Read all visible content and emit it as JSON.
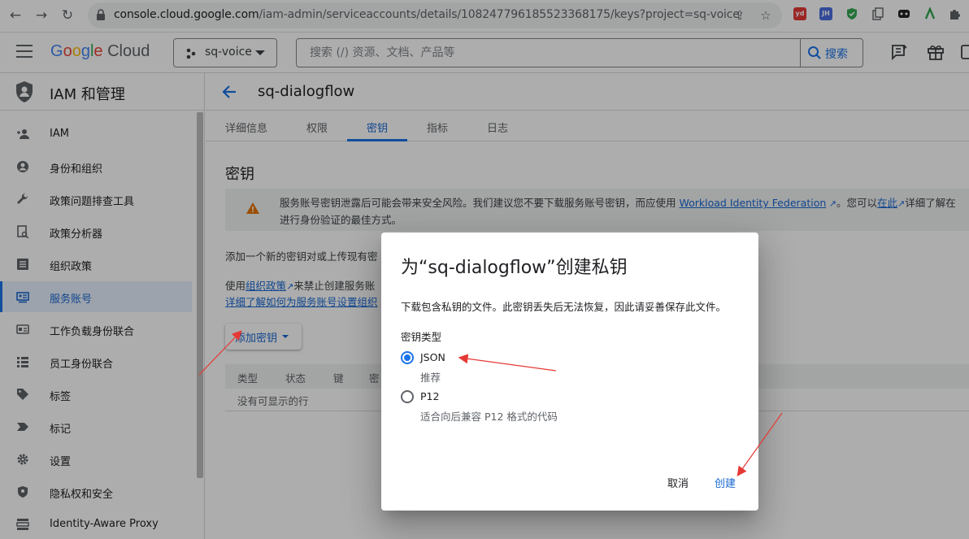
{
  "browser": {
    "url_host": "console.cloud.google.com",
    "url_path": "/iam-admin/serviceaccounts/details/108247796185523368175/keys?project=sq-voice",
    "extensions": [
      "yd",
      "JH"
    ]
  },
  "header": {
    "logo_google": "Google",
    "logo_cloud": "Cloud",
    "project_name": "sq-voice",
    "search_placeholder": "搜索 (/) 资源、文档、产品等",
    "search_button": "搜索"
  },
  "sidebar": {
    "title": "IAM 和管理",
    "items": [
      {
        "label": "IAM",
        "icon": "person-add-icon"
      },
      {
        "label": "身份和组织",
        "icon": "account-circle-icon"
      },
      {
        "label": "政策问题排查工具",
        "icon": "wrench-icon"
      },
      {
        "label": "政策分析器",
        "icon": "document-search-icon"
      },
      {
        "label": "组织政策",
        "icon": "list-alt-icon"
      },
      {
        "label": "服务账号",
        "icon": "service-account-icon",
        "active": true
      },
      {
        "label": "工作负载身份联合",
        "icon": "id-card-icon"
      },
      {
        "label": "员工身份联合",
        "icon": "list-icon"
      },
      {
        "label": "标签",
        "icon": "tag-icon"
      },
      {
        "label": "标记",
        "icon": "label-icon"
      },
      {
        "label": "设置",
        "icon": "gear-icon"
      },
      {
        "label": "隐私权和安全",
        "icon": "shield-icon"
      },
      {
        "label": "Identity-Aware Proxy",
        "icon": "proxy-icon"
      }
    ]
  },
  "main": {
    "title": "sq-dialogflow",
    "tabs": [
      {
        "label": "详细信息"
      },
      {
        "label": "权限"
      },
      {
        "label": "密钥",
        "active": true
      },
      {
        "label": "指标"
      },
      {
        "label": "日志"
      }
    ],
    "section_title": "密钥",
    "warning": {
      "text_before": "服务账号密钥泄露后可能会带来安全风险。我们建议您不要下载服务账号密钥，而应使用 ",
      "link1": "Workload Identity Federation",
      "text_mid": "。您可以",
      "link2": "在此",
      "text_after": "详细了解在",
      "line2": "进行身份验证的最佳方式。"
    },
    "desc1": "添加一个新的密钥对或上传现有密",
    "desc2_before": "使用",
    "desc2_link": "组织政策",
    "desc2_after": "来禁止创建服务账",
    "desc3": "详细了解如何为服务账号设置组织",
    "add_key_button": "添加密钥",
    "table": {
      "columns": [
        "类型",
        "状态",
        "键",
        "密"
      ],
      "empty_text": "没有可显示的行"
    }
  },
  "dialog": {
    "title": "为“sq-dialogflow”创建私钥",
    "description": "下载包含私钥的文件。此密钥丢失后无法恢复，因此请妥善保存此文件。",
    "key_type_label": "密钥类型",
    "options": [
      {
        "name": "JSON",
        "subtitle": "推荐",
        "selected": true
      },
      {
        "name": "P12",
        "subtitle": "适合向后兼容 P12 格式的代码",
        "selected": false
      }
    ],
    "cancel_button": "取消",
    "create_button": "创建"
  },
  "colors": {
    "accent": "#1a73e8",
    "annotation": "#e53935",
    "warning": "#e37400"
  }
}
